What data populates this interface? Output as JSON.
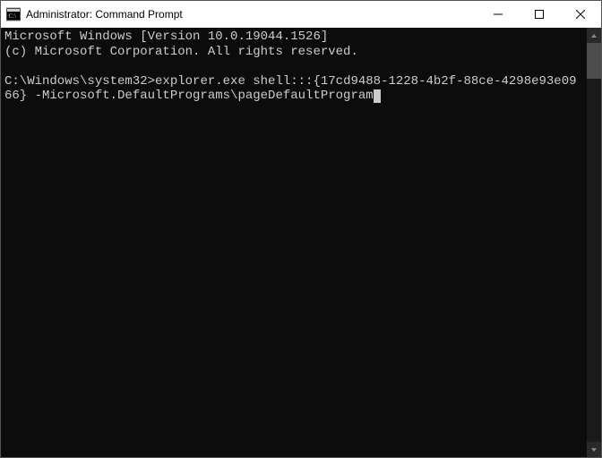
{
  "titlebar": {
    "icon_name": "cmd-icon",
    "title": "Administrator: Command Prompt"
  },
  "controls": {
    "minimize": "minimize",
    "maximize": "maximize",
    "close": "close"
  },
  "terminal": {
    "line1": "Microsoft Windows [Version 10.0.19044.1526]",
    "line2": "(c) Microsoft Corporation. All rights reserved.",
    "blank1": "",
    "prompt_path": "C:\\Windows\\system32>",
    "command": "explorer.exe shell:::{17cd9488-1228-4b2f-88ce-4298e93e0966} -Microsoft.DefaultPrograms\\pageDefaultProgram"
  }
}
